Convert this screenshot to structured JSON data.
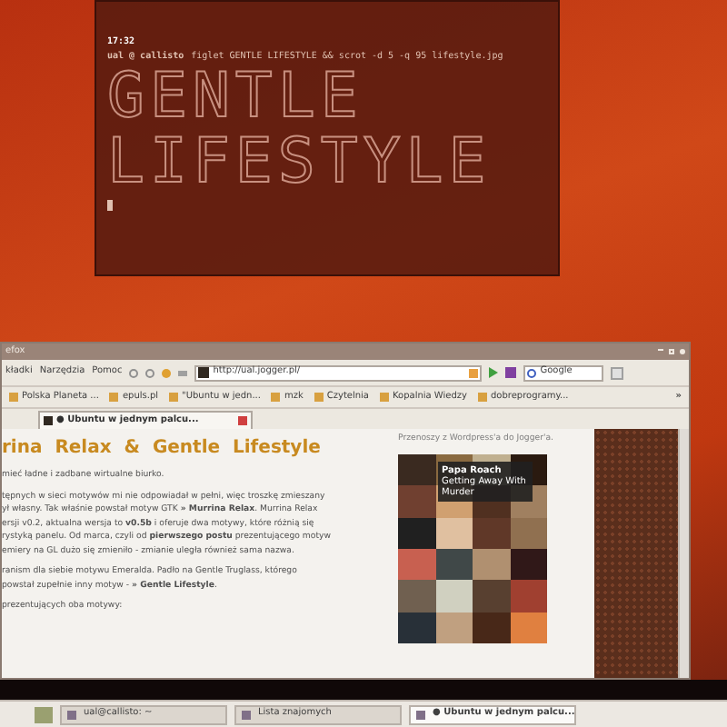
{
  "terminal": {
    "time": "17:32",
    "prompt": "ual @ callisto",
    "command": "figlet GENTLE LIFESTYLE && scrot -d 5 -q 95 lifestyle.jpg",
    "art": [
      "GENTLE",
      "LIFESTYLE"
    ]
  },
  "browser": {
    "title": "efox",
    "menu": [
      "kładki",
      "Narzędzia",
      "Pomoc"
    ],
    "url": "http://ual.jogger.pl/",
    "search": "Google",
    "bookmarks": [
      "Polska Planeta ...",
      "epuls.pl",
      "\"Ubuntu w jedn...",
      "mzk",
      "Czytelnia",
      "Kopalnia Wiedzy",
      "dobreprogramy..."
    ],
    "bookmarks_more": "»",
    "tabs": [
      {
        "label": "● Ubuntu w jednym palcu...",
        "selected": true
      }
    ],
    "heading": "rina  Relax  &  Gentle  Lifestyle",
    "paragraphs": [
      [
        "mieć ładne i zadbane wirtualne biurko."
      ],
      [
        "tępnych w sieci motywów mi nie odpowiadał w pełni, więc troszkę zmieszany",
        "ył własny. Tak właśnie powstał motyw GTK **» Murrina Relax**. Murrina Relax",
        "ersji v0.2, aktualna wersja to **v0.5b** i oferuje dwa motywy, które różnią się",
        "rystyką panelu. Od marca, czyli od **pierwszego postu** prezentującego motyw",
        "emiery na GL dużo się zmieniło - zmianie uległa również sama nazwa."
      ],
      [
        "ranism dla siebie motywu Emeralda. Padło na Gentle Truglass, którego",
        "powstał zupełnie inny motyw - **» Gentle Lifestyle**."
      ],
      [
        "prezentujących oba motywy:"
      ]
    ],
    "side_note": "Przenoszy z Wordpress'a do Jogger'a.",
    "tooltip": {
      "artist": "Papa Roach",
      "title": "Getting Away With Murder"
    }
  },
  "taskbar": {
    "items": [
      {
        "label": "ual@callisto: ~",
        "selected": false
      },
      {
        "label": "Lista znajomych",
        "selected": false
      },
      {
        "label": "● Ubuntu w jednym palcu...",
        "selected": true
      }
    ]
  }
}
